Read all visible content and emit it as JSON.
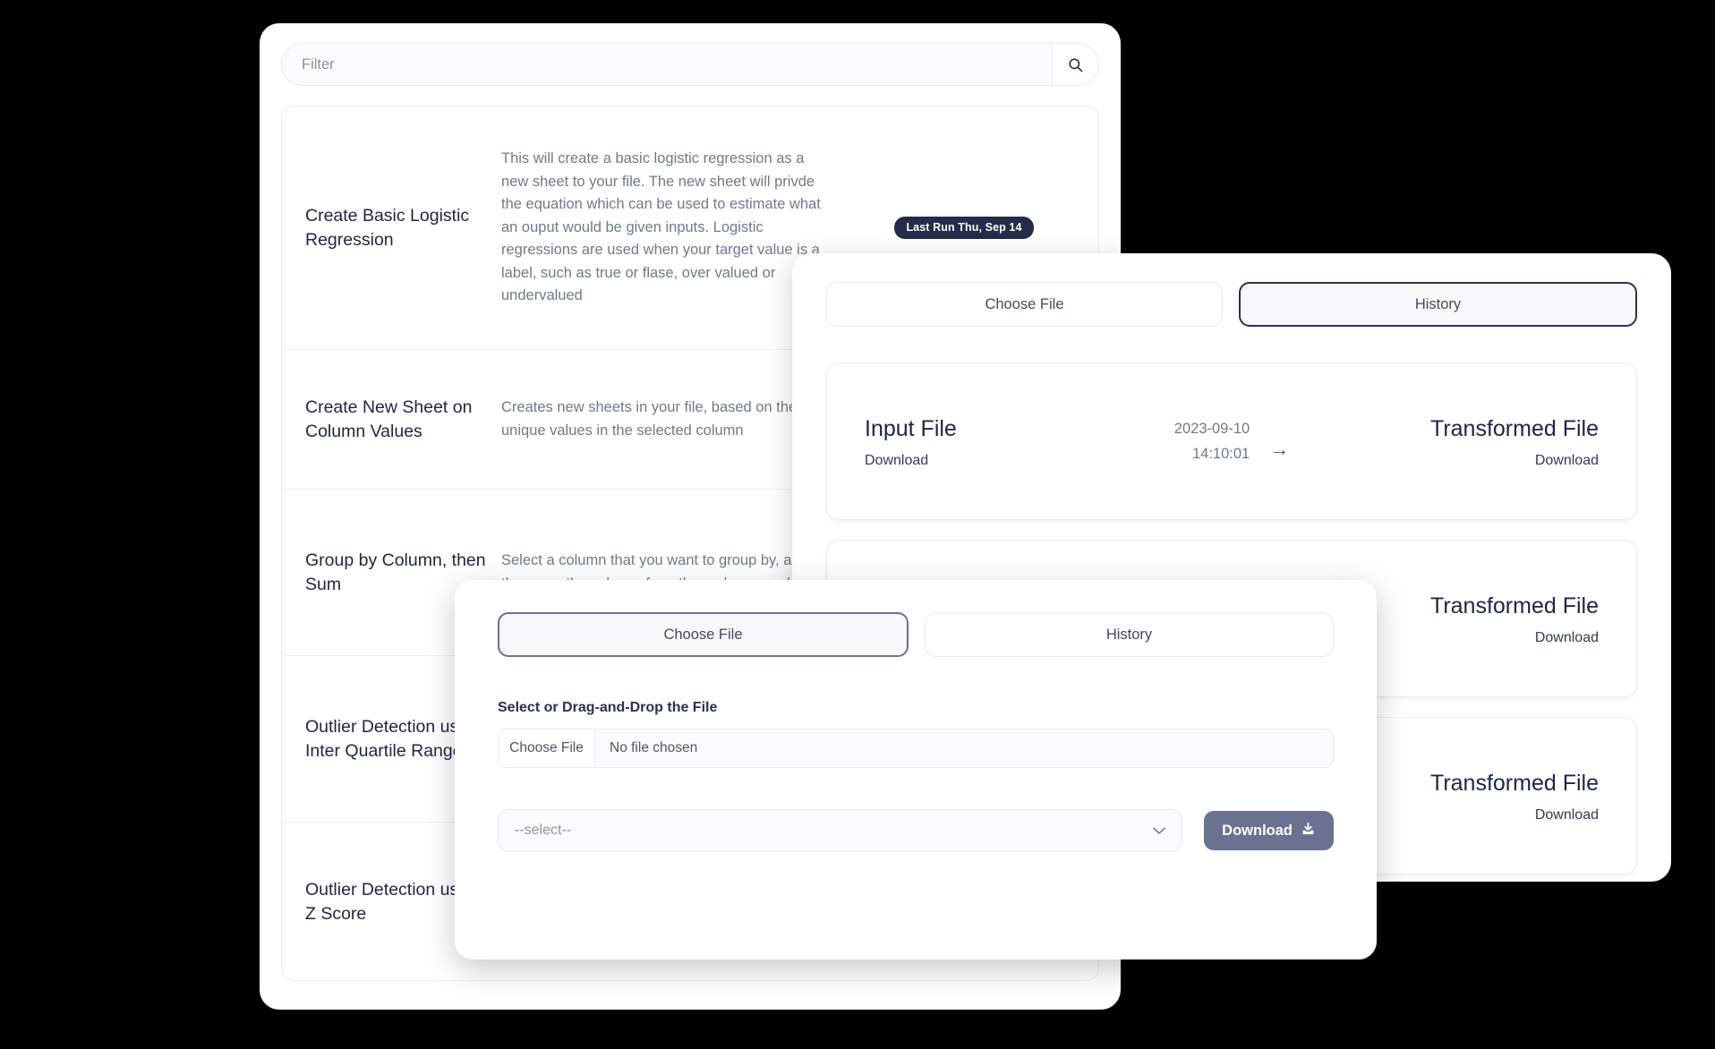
{
  "list_card": {
    "filter": {
      "placeholder": "Filter",
      "value": "",
      "search_icon": "search-icon"
    },
    "rows": [
      {
        "title": "Create Basic Logistic Regression",
        "description": "This will create a basic logistic regression as a new sheet to your file. The new sheet will privde the equation which can be used to estimate what an ouput would be given inputs. Logistic regressions are used when your target value is a label, such as true or flase, over valued or undervalued",
        "badge": "Last Run Thu, Sep 14"
      },
      {
        "title": "Create New Sheet on Column Values",
        "description": "Creates new sheets in your file, based on the unique values in the selected column",
        "badge": ""
      },
      {
        "title": "Group by Column, then Sum",
        "description": "Select a column that you want to group by, and then sum the values of another column, such",
        "badge": ""
      },
      {
        "title": "Outlier Detection using Inter Quartile Range",
        "description": "",
        "badge": ""
      },
      {
        "title": "Outlier Detection using Z Score",
        "description": "",
        "badge": ""
      }
    ]
  },
  "history_panel": {
    "tabs": [
      {
        "label": "Choose File",
        "active": false
      },
      {
        "label": "History",
        "active": true
      }
    ],
    "records": [
      {
        "input_title": "Input File",
        "input_link": "Download",
        "date": "2023-09-10",
        "time": "14:10:01",
        "arrow": "→",
        "output_title": "Transformed File",
        "output_link": "Download"
      },
      {
        "input_title": "",
        "input_link": "",
        "date": "",
        "time": "",
        "arrow": "",
        "output_title": "Transformed File",
        "output_link": "Download"
      },
      {
        "input_title": "",
        "input_link": "",
        "date": "",
        "time": "",
        "arrow": "",
        "output_title": "Transformed File",
        "output_link": "Download"
      }
    ]
  },
  "upload_modal": {
    "tabs": [
      {
        "label": "Choose File",
        "active": true
      },
      {
        "label": "History",
        "active": false
      }
    ],
    "drop_label": "Select or Drag-and-Drop the File",
    "file_button": "Choose File",
    "file_name": "No file chosen",
    "select_value": "--select--",
    "select_chevron": "chevron-down-icon",
    "download_label": "Download",
    "download_icon": "download-icon"
  },
  "colors": {
    "page_background": "#000000",
    "card_background": "#ffffff",
    "badge_background": "#252b48",
    "accent_dark": "#2a3152",
    "download_button": "#6b7190",
    "title_text": "#1e2545",
    "muted_text": "#6f7a8c"
  }
}
